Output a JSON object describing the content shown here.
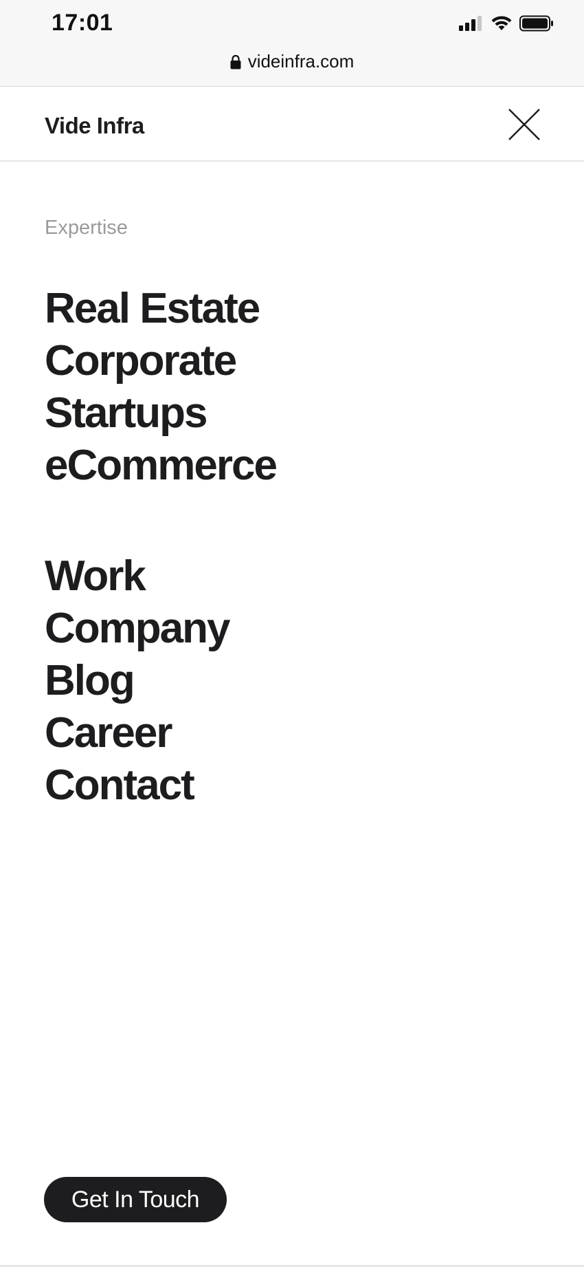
{
  "status_bar": {
    "time": "17:01",
    "url": "videinfra.com"
  },
  "header": {
    "brand": "Vide Infra",
    "close_icon": "close-icon"
  },
  "menu": {
    "section_label": "Expertise",
    "expertise_items": [
      {
        "label": "Real Estate"
      },
      {
        "label": "Corporate"
      },
      {
        "label": "Startups"
      },
      {
        "label": "eCommerce"
      }
    ],
    "main_items": [
      {
        "label": "Work"
      },
      {
        "label": "Company"
      },
      {
        "label": "Blog"
      },
      {
        "label": "Career"
      },
      {
        "label": "Contact"
      }
    ]
  },
  "cta": {
    "label": "Get In Touch"
  },
  "colors": {
    "text": "#1d1d1f",
    "muted": "#9a9a9a",
    "button_bg": "#1d1d1f",
    "button_text": "#ffffff"
  }
}
